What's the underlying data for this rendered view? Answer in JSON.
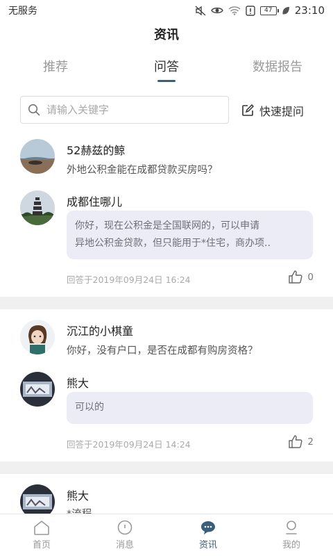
{
  "status_bar": {
    "carrier": "无服务",
    "battery": "47",
    "time": "23:10"
  },
  "header": {
    "title": "资讯"
  },
  "tabs": [
    {
      "label": "推荐"
    },
    {
      "label": "问答",
      "active": true
    },
    {
      "label": "数据报告"
    }
  ],
  "search": {
    "placeholder": "请输入关键字",
    "value": ""
  },
  "quick_ask": {
    "label": "快速提问"
  },
  "cards": [
    {
      "asker": "52赫兹的鲸",
      "question": "外地公积金能在成都贷款买房吗？",
      "answerer": "成都住哪儿",
      "answer_line1": "你好，现在公积金是全国联网的，可以申请",
      "answer_line2": "异地公积金贷款，但只能用于*住宅，商办项..",
      "answered_at": "回答于2019年09月24日 16:24",
      "likes": "0"
    },
    {
      "asker": "沉江的小棋童",
      "question": "你好，没有户口，是否在成都有购房资格？",
      "answerer": "熊大",
      "answer_line1": "可以的",
      "answered_at": "回答于2019年09月24日 14:24",
      "likes": "2"
    },
    {
      "asker": "熊大",
      "question": "*流程"
    }
  ],
  "bottom_nav": [
    {
      "label": "首页",
      "icon": "home-icon"
    },
    {
      "label": "消息",
      "icon": "message-icon"
    },
    {
      "label": "资讯",
      "icon": "news-icon",
      "active": true
    },
    {
      "label": "我的",
      "icon": "profile-icon"
    }
  ],
  "colors": {
    "accent": "#3a5f7d",
    "bubble": "#ececf6",
    "divider": "#f0f0f0"
  }
}
